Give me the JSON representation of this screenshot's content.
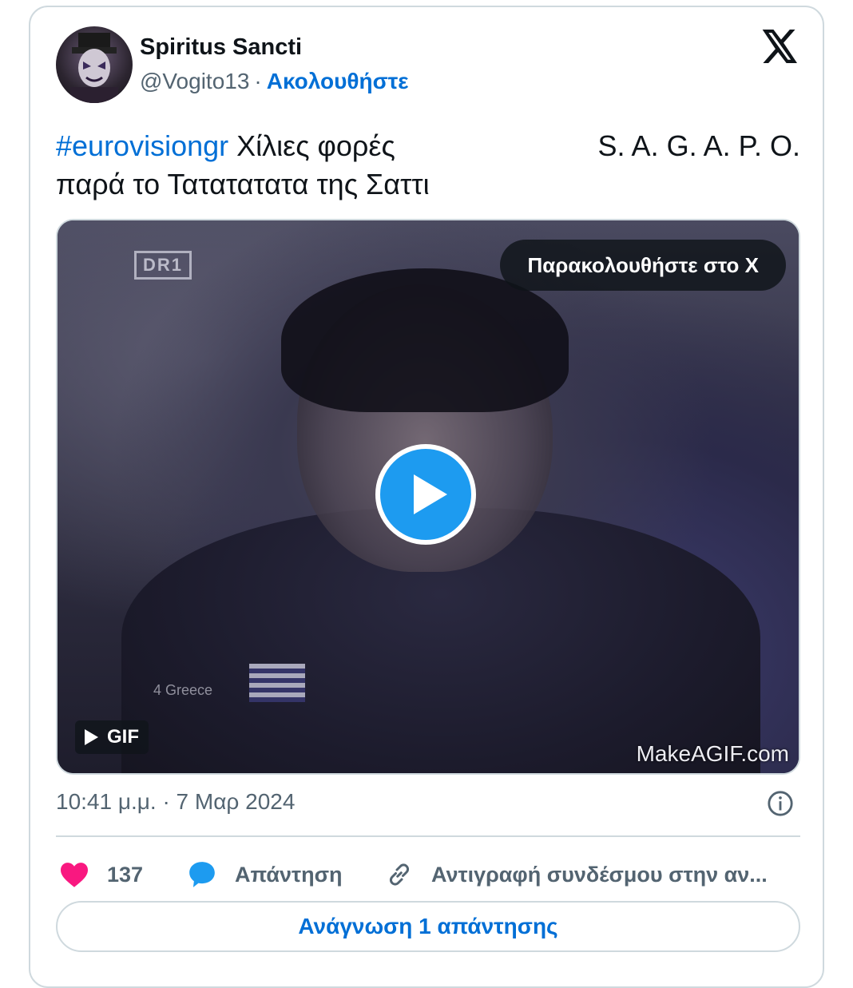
{
  "author": {
    "name": "Spiritus Sancti",
    "handle": "@Vogito13",
    "separator": "·",
    "follow_label": "Ακολουθήστε"
  },
  "tweet": {
    "hashtag": "#eurovisiongr",
    "text_line1": "Χίλιες φορές",
    "text_right": "S. A. G. A. P. O.",
    "text_line2": "παρά το Τατατατατα της Σαττι"
  },
  "media": {
    "watch_label": "Παρακολουθήστε στο X",
    "gif_label": "GIF",
    "watermark": "MakeAGIF.com",
    "channel_logo": "DR1",
    "caption": "4 Greece"
  },
  "meta": {
    "timestamp": "10:41 μ.μ. · 7 Μαρ 2024"
  },
  "actions": {
    "like_count": "137",
    "reply_label": "Απάντηση",
    "copy_link_label": "Αντιγραφή συνδέσμου στην αν..."
  },
  "footer": {
    "read_replies_label": "Ανάγνωση 1 απάντησης"
  },
  "colors": {
    "accent": "#1d9bf0",
    "link": "#006fd6",
    "like": "#f91880",
    "muted": "#536471",
    "border": "#cfd9de"
  },
  "icons": {
    "brand": "x-logo-icon",
    "play": "play-icon",
    "info": "info-icon",
    "like": "heart-icon",
    "reply": "speech-bubble-icon",
    "copy": "link-icon"
  }
}
